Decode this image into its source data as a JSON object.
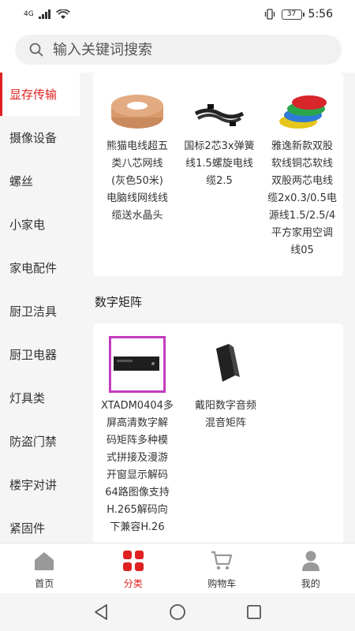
{
  "status": {
    "signal": "4G",
    "battery": "37",
    "time": "5:56"
  },
  "search": {
    "placeholder": "输入关键词搜索"
  },
  "sidebar": {
    "items": [
      {
        "label": "显存传输"
      },
      {
        "label": "摄像设备"
      },
      {
        "label": "螺丝"
      },
      {
        "label": "小家电"
      },
      {
        "label": "家电配件"
      },
      {
        "label": "厨卫洁具"
      },
      {
        "label": "厨卫电器"
      },
      {
        "label": "灯具类"
      },
      {
        "label": "防盗门禁"
      },
      {
        "label": "楼宇对讲"
      },
      {
        "label": "紧固件"
      }
    ]
  },
  "products_top": [
    {
      "line1": "熊猫电线超五",
      "line2": "类八芯网线",
      "line3": "(灰色50米)",
      "line4": "电脑线网线线",
      "line5": "缆送水晶头"
    },
    {
      "line1": "国标2芯3x弹簧",
      "line2": "线1.5螺旋电线",
      "line3": "缆2.5"
    },
    {
      "line1": "雅逸新款双股",
      "line2": "软线铜芯软线",
      "line3": "双股两芯电线",
      "line4": "缆2x0.3/0.5电",
      "line5": "源线1.5/2.5/4",
      "line6": "平方家用空调",
      "line7": "线05"
    }
  ],
  "section2": {
    "title": "数字矩阵"
  },
  "products_matrix": [
    {
      "line1": "XTADM0404多",
      "line2": "屏高清数字解",
      "line3": "码矩阵多种模",
      "line4": "式拼接及漫游",
      "line5": "开窗显示解码",
      "line6": "64路图像支持",
      "line7": "H.265解码向",
      "line8": "下兼容H.26"
    },
    {
      "line1": "戴阳数字音频",
      "line2": "混音矩阵"
    }
  ],
  "tabbar": {
    "tabs": [
      {
        "label": "首页"
      },
      {
        "label": "分类"
      },
      {
        "label": "购物车"
      },
      {
        "label": "我的"
      }
    ]
  },
  "colors": {
    "accent": "#e02020",
    "background": "#f5f5f5"
  }
}
